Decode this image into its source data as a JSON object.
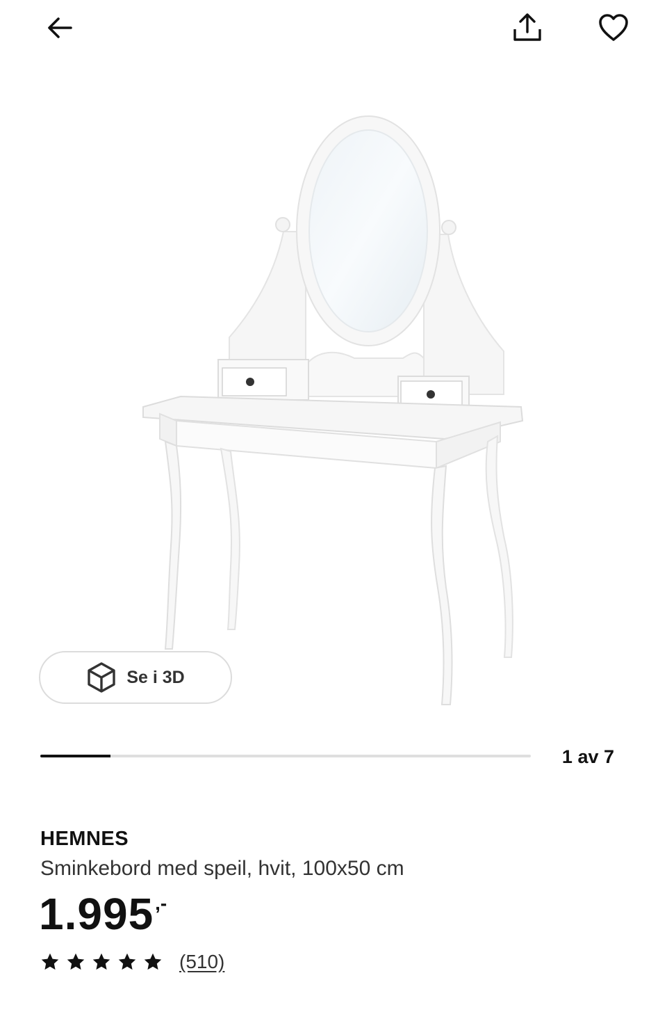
{
  "header": {
    "back_icon": "arrow-left-icon",
    "share_icon": "share-upload-icon",
    "favorite_icon": "heart-outline-icon"
  },
  "gallery": {
    "image_subject": "white dressing table with oval mirror and two small drawers",
    "view_3d_label": "Se i 3D",
    "view_3d_icon": "cube-icon",
    "pager_text": "1 av 7",
    "current_image": 1,
    "total_images": 7
  },
  "product": {
    "name": "HEMNES",
    "description": "Sminkebord med speil, hvit, 100x50 cm",
    "price": "1.995",
    "price_suffix": ",-",
    "rating": 5,
    "review_count": "(510)"
  },
  "colors": {
    "text": "#111111",
    "progress_track": "#dfdfdf",
    "progress_fill": "#111111",
    "button_border": "#dcdcdc"
  }
}
